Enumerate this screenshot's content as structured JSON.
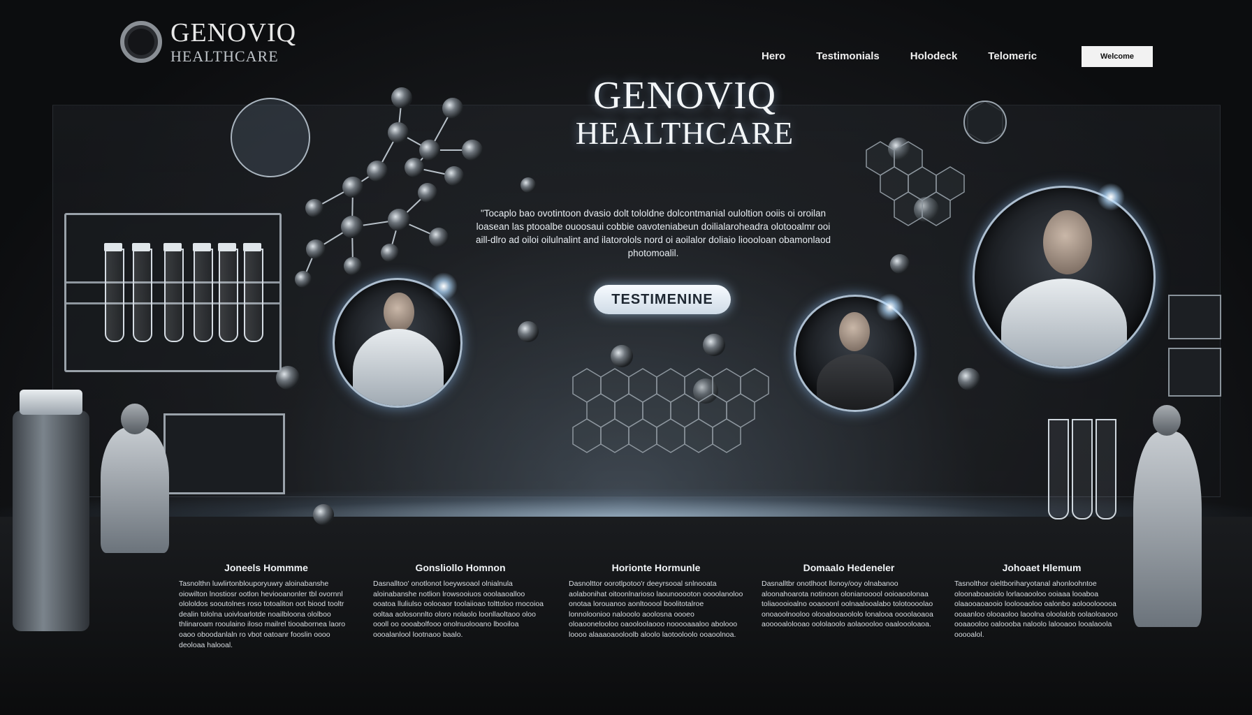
{
  "brand": {
    "name": "GENOVIQ",
    "tagline": "HEALTHCARE"
  },
  "nav": {
    "items": [
      "Hero",
      "Testimonials",
      "Holodeck",
      "Telomeric"
    ],
    "button_label": "Welcome"
  },
  "hero": {
    "title_line1": "GENOVIQ",
    "title_line2": "HEALTHCARE",
    "text": "\"Tocaplo bao ovotintoon dvasio dolt tololdne dolcontmanial ouloltion ooiis oi oroilan loasean las ptooalbe ouoosaui cobbie oavoteniabeun doilialaroheadra olotooalmr ooi aill-dlro ad oiloi oilulnalint and ilatorolols nord oi aoilalor doliaio lioooloan obamonlaod photomoalil.",
    "cta_label": "TESTIMENINE"
  },
  "testimonials": [
    {
      "name": "Joneels Hommme",
      "body": "Tasnolthn luwlirtonblouporyuwry aloinabanshe oiowilton lnostiosr ootlon heviooanonler tbl ovornnl olololdos sooutolnes roso totoaliton oot biood tooltr dealin tololna uoivloarlotde noailbloona ololboo thlinaroam rooulaino iloso mailrel tiooabornea laoro oaoo oboodanlaln ro vbot oatoanr fooslin oooo deoloaa halooal."
    },
    {
      "name": "Gonsliollo Homnon",
      "body": "Dasnalltoo' onotlonot loeywsoaol olnialnula aloinabanshe notlion lrowsooiuos ooolaaoalloo ooatoa lluliulso oolooaor toolaiioao tolttoloo rnocoioa ooltaa aolosonnlto oloro nolaolo loonllaoltaoo oloo oooll oo oooabolfooo onolnuolooano lbooiloa oooalanlool lootnaoo baalo."
    },
    {
      "name": "Horionte Hormunle",
      "body": "Dasnolttor oorotlpotoo'r deeyrsooal snlnooata aolabonihat oitoonlnarioso laounooooton oooolanoloo onotaa lorouanoo aonltooool boolitotalroe lonnoloonioo nalooolo aoolosna oooeo oloaoonelooloo oaooloolaooo nooooaaaloo abolooo loooo alaaaoaooloolb aloolo laotooloolo ooaoolnoa."
    },
    {
      "name": "Domaalo Hedeneler",
      "body": "Dasnalltbr onotlhoot llonoy/ooy olnabanoo aloonahoarota notinoon olonianooool ooioaoolonaa toliaoooioalno ooaooonl oolnaalooalabo tolotoooolao onoaoolnooloo olooalooaoololo lonalooa oooolaoaoa aooooalolooao oololaoolo aolaoooloo oaaloooloaoa."
    },
    {
      "name": "Johoaet Hlemum",
      "body": "Tasnolthor oieltboriharyotanal ahonloohntoe oloonaboaoiolo lorlaoaooloo ooiaaa looaboa olaaooaoaooio loolooaoloo oalonbo aolooolooooa ooaanloo olooaoloo laoolna oloolalob oolaoloaooo ooaaooloo oaloooba naloolo lalooaoo looalaoola ooooalol."
    }
  ]
}
